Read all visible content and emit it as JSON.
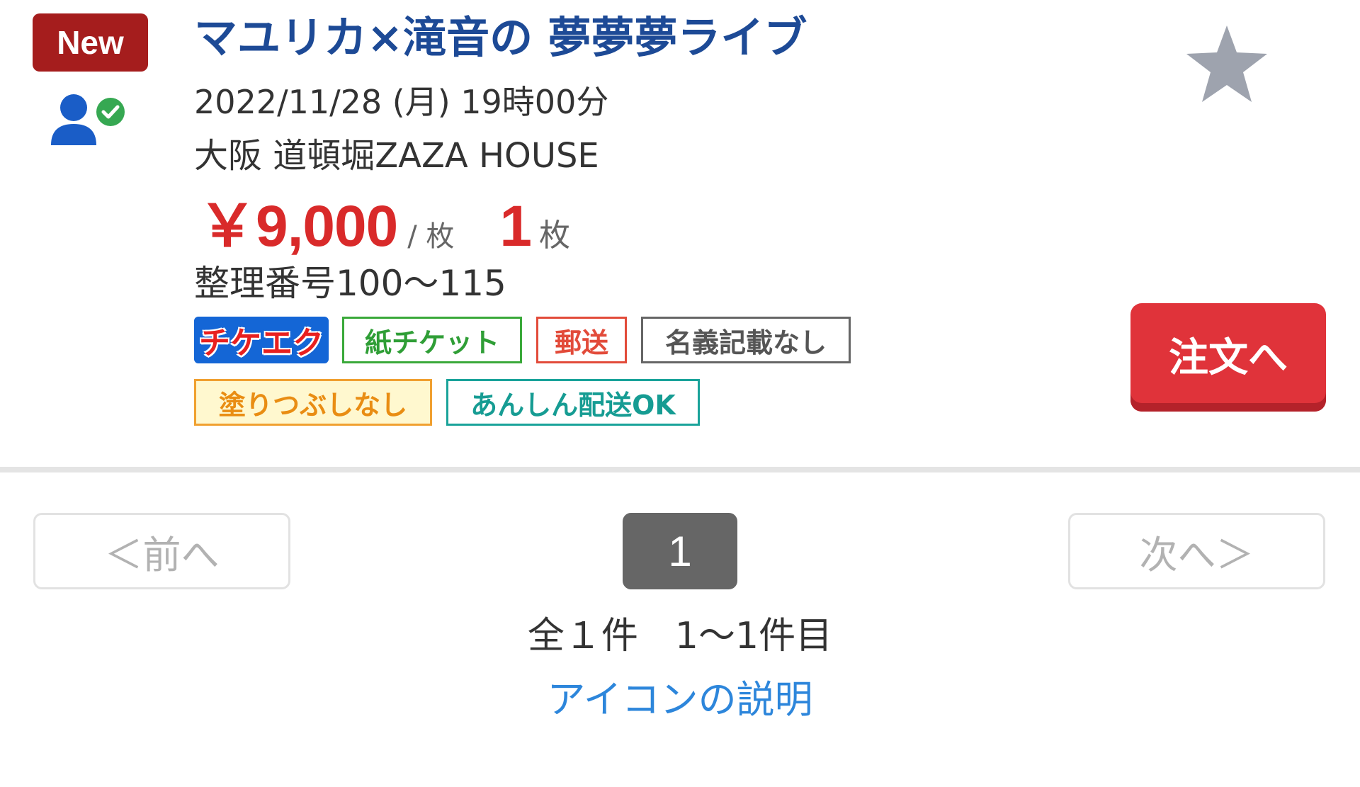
{
  "listing": {
    "new_badge": "New",
    "title": "マユリカ×滝音の 夢夢夢ライブ",
    "date": "2022/11/28 (月) 19時00分",
    "venue": "大阪 道頓堀ZAZA HOUSE",
    "price": "￥9,000",
    "price_unit": "/ 枚",
    "quantity": "1",
    "quantity_unit": "枚",
    "ticket_number": "整理番号100〜115",
    "tags": {
      "tikeeku": "チケエク",
      "paper_ticket": "紙チケット",
      "mail": "郵送",
      "no_name": "名義記載なし",
      "no_fill": "塗りつぶしなし",
      "safe_delivery": "あんしん配送OK"
    },
    "order_button": "注文へ",
    "colors": {
      "title": "#1d4a96",
      "price": "#d92a2a",
      "order_button": "#e0333a",
      "new_badge": "#a51d1d",
      "star": "#9ea3ae"
    },
    "icons": {
      "seller": "verified-user-icon",
      "favorite": "star-icon"
    }
  },
  "pagination": {
    "prev": "＜前へ",
    "next": "次へ＞",
    "current_page": "1",
    "result_count": "全１件　1〜1件目"
  },
  "footer": {
    "icon_help": "アイコンの説明"
  }
}
